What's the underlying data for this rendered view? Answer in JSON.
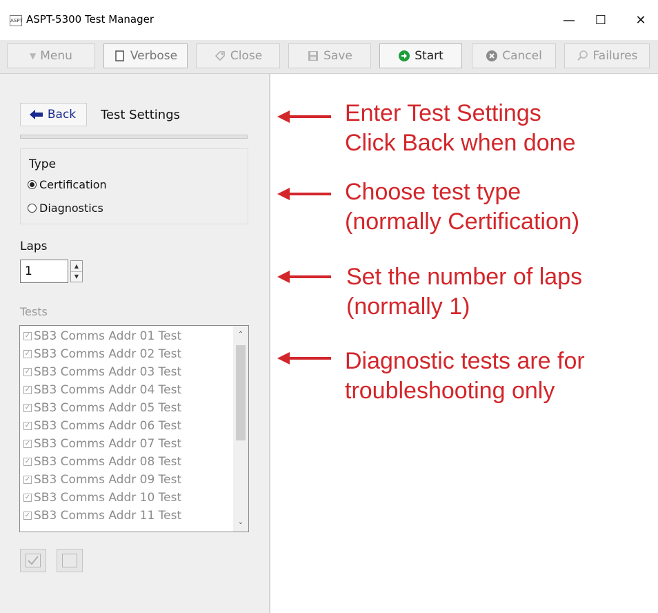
{
  "window": {
    "icon_text": "ASPT",
    "title": "ASPT-5300 Test Manager",
    "minimize": "—",
    "maximize": "☐",
    "close": "✕"
  },
  "toolbar": {
    "menu": "Menu",
    "verbose": "Verbose",
    "close": "Close",
    "save": "Save",
    "start": "Start",
    "cancel": "Cancel",
    "failures": "Failures"
  },
  "panel": {
    "back": "Back",
    "title": "Test Settings",
    "type_label": "Type",
    "type_options": [
      "Certification",
      "Diagnostics"
    ],
    "type_selected": "Certification",
    "laps_label": "Laps",
    "laps_value": "1",
    "tests_label": "Tests",
    "tests": [
      "SB3 Comms Addr 01 Test",
      "SB3 Comms Addr 02 Test",
      "SB3 Comms Addr 03 Test",
      "SB3 Comms Addr 04 Test",
      "SB3 Comms Addr 05 Test",
      "SB3 Comms Addr 06 Test",
      "SB3 Comms Addr 07 Test",
      "SB3 Comms Addr 08 Test",
      "SB3 Comms Addr 09 Test",
      "SB3 Comms Addr 10 Test",
      "SB3 Comms Addr 11 Test"
    ]
  },
  "annotations": {
    "settings": "Enter Test Settings\nClick Back when done",
    "type": "Choose test type\n(normally Certification)",
    "laps": "Set the number of laps\n(normally 1)",
    "tests": "Diagnostic tests are for\ntroubleshooting only"
  },
  "colors": {
    "annotation_red": "#d3262b",
    "back_arrow_blue": "#1a2b8f",
    "start_green": "#1e9e3a"
  }
}
